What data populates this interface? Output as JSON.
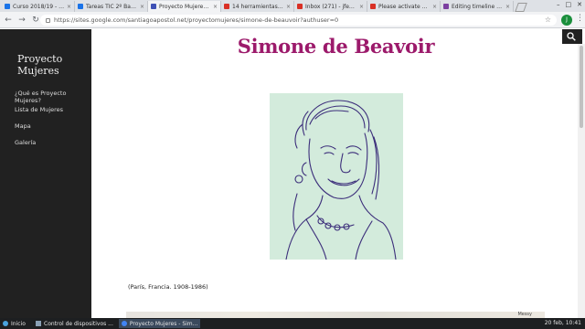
{
  "browser": {
    "tabs": [
      {
        "label": "Curso 2018/19 - escr",
        "favicon_color": "#1a73e8",
        "active": false
      },
      {
        "label": "Tareas TIC 2º Bachill",
        "favicon_color": "#1a73e8",
        "active": false
      },
      {
        "label": "Proyecto Mujeres - S",
        "favicon_color": "#3f51b5",
        "active": true
      },
      {
        "label": "14 herramientas par",
        "favicon_color": "#d93025",
        "active": false
      },
      {
        "label": "Inbox (271) - jfemar",
        "favicon_color": "#d93025",
        "active": false
      },
      {
        "label": "Please activate your",
        "favicon_color": "#d93025",
        "active": false
      },
      {
        "label": "Editing timeline Muj",
        "favicon_color": "#7b3fa0",
        "active": false
      }
    ],
    "url": "https://sites.google.com/santiagoapostol.net/proyectomujeres/simone-de-beauvoir?authuser=0",
    "profile_initial": "J",
    "window_controls": [
      "–",
      "□",
      "✕"
    ]
  },
  "sidebar": {
    "site_title": "Proyecto Mujeres",
    "items": [
      {
        "label": "¿Qué es Proyecto Mujeres?"
      },
      {
        "label": "Lista de Mujeres"
      },
      {
        "label": "Mapa"
      },
      {
        "label": "Galería"
      }
    ]
  },
  "main": {
    "heading": "Simone de Beavoir",
    "caption": "(París, Francia. 1908-1986)",
    "heading_color": "#9c1a6b",
    "map_label": "Messy"
  },
  "taskbar": {
    "start_label": "Inicio",
    "tasks": [
      {
        "label": "Control de dispositivos ..."
      },
      {
        "label": "Proyecto Mujeres - Sim..."
      }
    ],
    "clock": "20 feb, 10:41"
  }
}
